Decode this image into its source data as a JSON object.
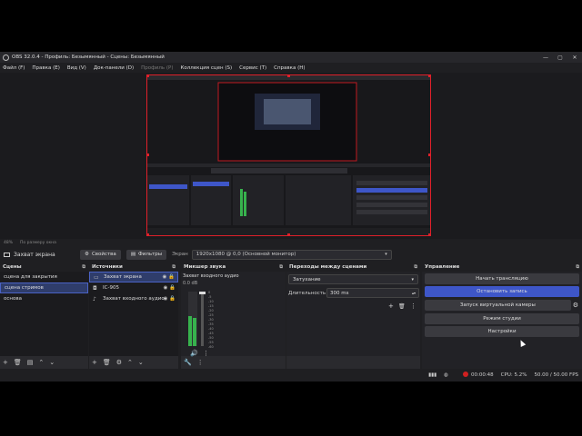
{
  "titlebar": {
    "title": "OBS 32.0.4 - Профиль: Безымянный - Сцены: Безымянный",
    "minimize": "—",
    "maximize": "▢",
    "close": "✕"
  },
  "menu": [
    {
      "label": "Файл (F)",
      "enabled": true
    },
    {
      "label": "Правка (E)",
      "enabled": true
    },
    {
      "label": "Вид (V)",
      "enabled": true
    },
    {
      "label": "Док-панели (D)",
      "enabled": true
    },
    {
      "label": "Профиль (P)",
      "enabled": false
    },
    {
      "label": "Коллекция сцен (S)",
      "enabled": true
    },
    {
      "label": "Сервис (T)",
      "enabled": true
    },
    {
      "label": "Справка (H)",
      "enabled": true
    }
  ],
  "zoomrow": {
    "zoom": "48%",
    "fit": "По размеру окна"
  },
  "context": {
    "source_name": "Захват экрана",
    "properties": "Свойства",
    "filters": "Фильтры",
    "screen_label": "Экран",
    "screen_value": "1920x1080 @ 0,0 (Основной монитор)"
  },
  "scenes": {
    "title": "Сцены",
    "items": [
      "сцена для закрытия",
      "сцена стримов",
      "основа"
    ],
    "active_index": 1
  },
  "sources": {
    "title": "Источники",
    "items": [
      {
        "label": "Захват экрана",
        "icon": "monitor-icon",
        "active": true
      },
      {
        "label": "IC-905",
        "icon": "camera-icon",
        "active": false
      },
      {
        "label": "Захват входного аудио",
        "icon": "microphone-icon",
        "active": false
      }
    ]
  },
  "mixer": {
    "title": "Микшер звука",
    "channel_name": "Захват входного аудио",
    "db": "0.0 dB",
    "scale": [
      "0",
      "-5",
      "-10",
      "-15",
      "-20",
      "-25",
      "-30",
      "-35",
      "-40",
      "-45",
      "-50",
      "-55",
      "-60"
    ],
    "level": 0.55
  },
  "transitions": {
    "title": "Переходы между сценами",
    "selected": "Затухание",
    "duration_label": "Длительность",
    "duration_value": "300 ms"
  },
  "controls": {
    "title": "Управление",
    "buttons": [
      {
        "label": "Начать трансляцию",
        "active": false
      },
      {
        "label": "Остановить запись",
        "active": true
      },
      {
        "label": "Запуск виртуальной камеры",
        "active": false
      },
      {
        "label": "Режим студии",
        "active": false
      },
      {
        "label": "Настройки",
        "active": false
      }
    ]
  },
  "status": {
    "record_time": "00:00:48",
    "cpu": "CPU: 5.2%",
    "fps": "50.00 / 50.00 FPS"
  },
  "colors": {
    "accent": "#3e56c8",
    "record": "#d02020",
    "border": "#e0202a"
  }
}
